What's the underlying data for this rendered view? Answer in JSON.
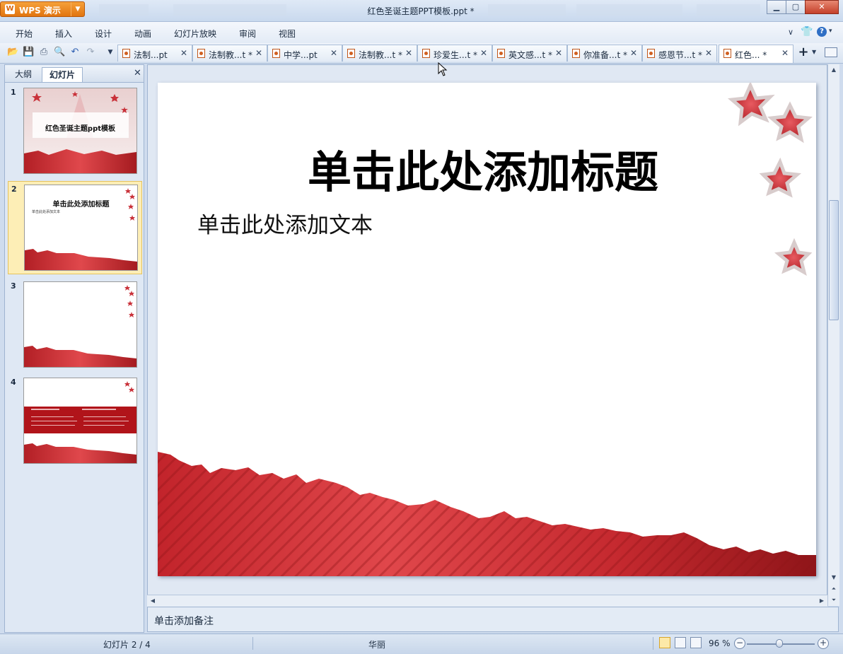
{
  "app": {
    "name": "WPS 演示",
    "window_title": "红色圣诞主题PPT模板.ppt *"
  },
  "menu": [
    "开始",
    "插入",
    "设计",
    "动画",
    "幻灯片放映",
    "审阅",
    "视图"
  ],
  "doc_tabs": [
    {
      "label": "法制...pt",
      "active": false
    },
    {
      "label": "法制教...t *",
      "active": false
    },
    {
      "label": "中学...pt",
      "active": false
    },
    {
      "label": "法制教...t *",
      "active": false
    },
    {
      "label": "珍爱生...t *",
      "active": false
    },
    {
      "label": "英文感...t *",
      "active": false
    },
    {
      "label": "你准备...t *",
      "active": false
    },
    {
      "label": "感恩节...t *",
      "active": false
    },
    {
      "label": "红色... *",
      "active": true
    }
  ],
  "left_panel": {
    "tabs": [
      {
        "label": "大纲",
        "active": false
      },
      {
        "label": "幻灯片",
        "active": true
      }
    ],
    "slides": [
      {
        "num": "1",
        "title": "红色圣诞主题ppt模板"
      },
      {
        "num": "2",
        "title": "单击此处添加标题",
        "body": "单击此处添加文本"
      },
      {
        "num": "3"
      },
      {
        "num": "4"
      }
    ],
    "selected_index": 2
  },
  "slide": {
    "title": "单击此处添加标题",
    "body": "单击此处添加文本"
  },
  "notes_placeholder": "单击添加备注",
  "status": {
    "slide_counter": "幻灯片 2 / 4",
    "theme": "华丽",
    "zoom": "96 %",
    "zoom_value": 96
  },
  "colors": {
    "accent_red": "#c0282e",
    "orange": "#e2740f"
  }
}
